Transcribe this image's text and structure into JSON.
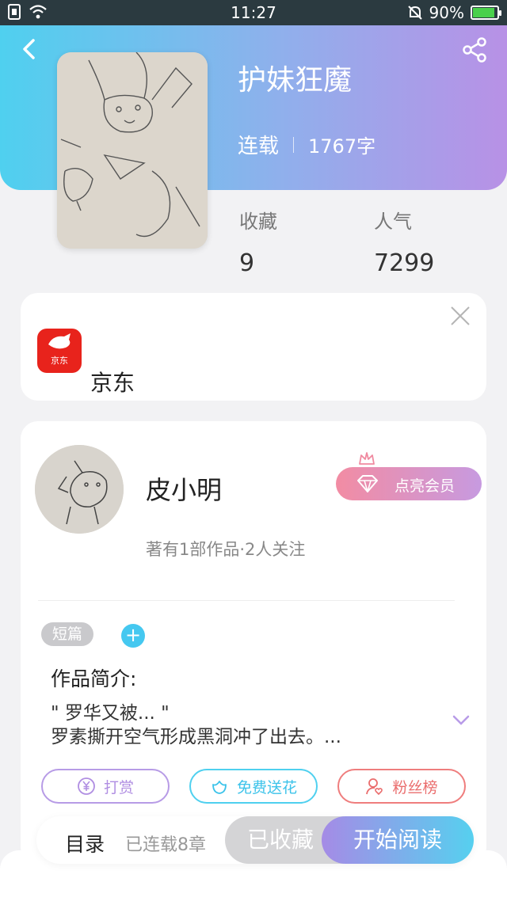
{
  "status_bar": {
    "time": "11:27",
    "battery": "90%"
  },
  "book": {
    "title": "护妹狂魔",
    "status": "连载",
    "word_count": "1767字",
    "favorites_label": "收藏",
    "favorites_value": "9",
    "popularity_label": "人气",
    "popularity_value": "7299"
  },
  "ad": {
    "logo_text": "京东",
    "name": "京东"
  },
  "author": {
    "name": "皮小明",
    "stats": "著有1部作品·2人关注",
    "vip_label": "点亮会员"
  },
  "tags": {
    "short": "短篇",
    "add": "+"
  },
  "intro": {
    "title": "作品简介:",
    "line1": "\" 罗华又被... \"",
    "line2": "罗素撕开空气形成黑洞冲了出去。..."
  },
  "actions": {
    "tip": "打赏",
    "flower": "免费送花",
    "fans": "粉丝榜"
  },
  "bottom": {
    "toc": "目录",
    "chapters": "已连载8章",
    "collected": "已收藏",
    "read": "开始阅读"
  },
  "colors": {
    "header_start": "#4fd0ef",
    "header_end": "#b891e6",
    "accent_blue": "#45c8f0",
    "accent_purple": "#b08ee2",
    "accent_red": "#ea6d6d"
  }
}
